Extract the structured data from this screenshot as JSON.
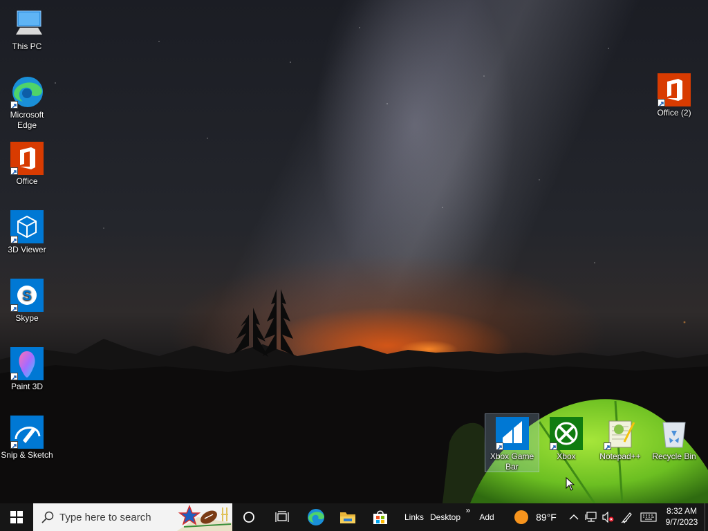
{
  "desktop": {
    "icons": [
      {
        "label": "This PC"
      },
      {
        "label": "Microsoft Edge"
      },
      {
        "label": "Office"
      },
      {
        "label": "3D Viewer"
      },
      {
        "label": "Skype"
      },
      {
        "label": "Paint 3D"
      },
      {
        "label": "Snip & Sketch"
      },
      {
        "label": "Office (2)"
      },
      {
        "label": "Xbox Game Bar"
      },
      {
        "label": "Xbox"
      },
      {
        "label": "Notepad++"
      },
      {
        "label": "Recycle Bin"
      }
    ],
    "selected_icon": "Xbox Game Bar"
  },
  "taskbar": {
    "search_placeholder": "Type here to search",
    "toolbar_links": "Links",
    "toolbar_desktop": "Desktop",
    "toolbar_more": "»",
    "toolbar_add": "Add",
    "weather": "89°F",
    "time": "8:32 AM",
    "date": "9/7/2023"
  },
  "colors": {
    "taskbar_bg": "#161616",
    "office_red": "#d83b01",
    "windows_blue": "#0078d4",
    "xbox_green": "#107c10",
    "skype_blue": "#0078d4",
    "weather_sun": "#f7941d"
  },
  "icons_semantic": [
    "start-icon",
    "search-icon",
    "cortana-icon",
    "task-view-icon",
    "edge-icon",
    "file-explorer-icon",
    "store-icon",
    "weather-icon",
    "chevron-up-icon",
    "network-icon",
    "volume-muted-icon",
    "pen-icon",
    "keyboard-icon"
  ]
}
